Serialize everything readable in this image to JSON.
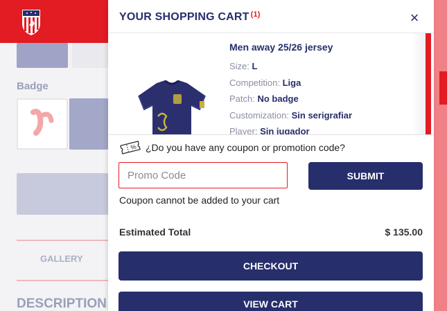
{
  "background": {
    "badge_label": "Badge",
    "gallery_label": "GALLERY",
    "description_label": "DESCRIPTION"
  },
  "cart": {
    "title": "YOUR SHOPPING CART",
    "count": "(1)",
    "close_icon": "×",
    "item": {
      "name": "Men away 25/26 jersey",
      "attributes": [
        {
          "label": "Size:",
          "value": "L"
        },
        {
          "label": "Competition:",
          "value": "Liga"
        },
        {
          "label": "Patch:",
          "value": "No badge"
        },
        {
          "label": "Customization:",
          "value": "Sin serigrafiar"
        },
        {
          "label": "Player:",
          "value": "Sin jugador"
        }
      ]
    },
    "coupon": {
      "question": "¿Do you have any coupon or promotion code?",
      "placeholder": "Promo Code",
      "submit_label": "SUBMIT",
      "error": "Coupon cannot be added to your cart"
    },
    "total": {
      "label": "Estimated Total",
      "value": "$ 135.00"
    },
    "checkout_label": "CHECKOUT",
    "view_cart_label": "VIEW CART"
  },
  "colors": {
    "navy": "#262e6b",
    "red": "#e31b23"
  },
  "icons": [
    "atletico-crest-icon",
    "close-icon",
    "coupon-ticket-icon",
    "jersey-image"
  ]
}
